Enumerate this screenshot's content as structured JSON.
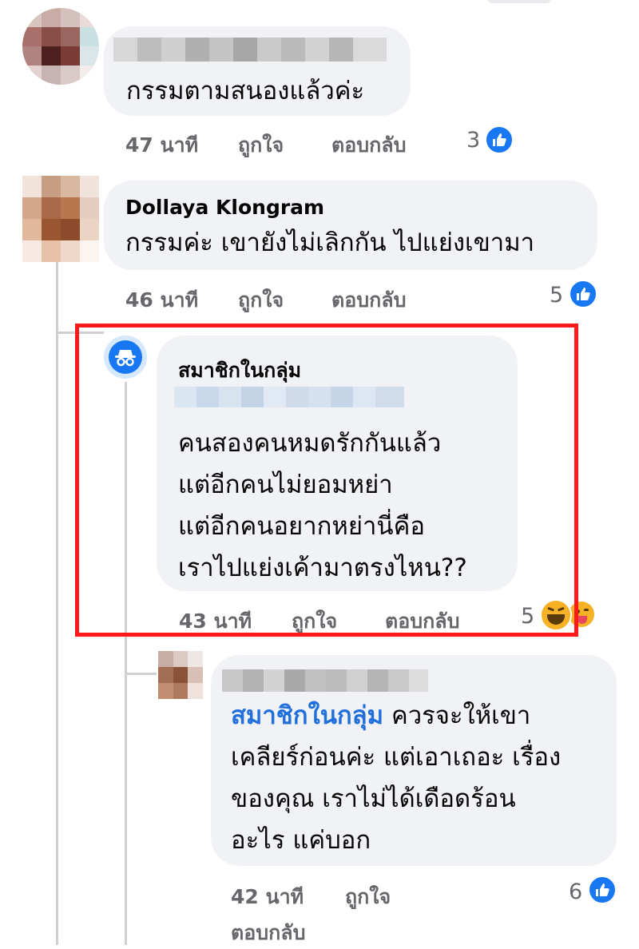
{
  "comments": [
    {
      "name": "",
      "text": [
        "กรรมตามสนองแล้วค่ะ"
      ],
      "time": "47 นาที",
      "like_label": "ถูกใจ",
      "reply_label": "ตอบกลับ",
      "reaction_count": "3",
      "reaction": "like-icon"
    },
    {
      "name": "Dollaya Klongram",
      "text": [
        "กรรมค่ะ เขายังไม่เลิกกัน ไปแย่งเขามา"
      ],
      "time": "46 นาที",
      "like_label": "ถูกใจ",
      "reply_label": "ตอบกลับ",
      "reaction_count": "5",
      "reaction": "like-icon"
    },
    {
      "name": "สมาชิกในกลุ่ม",
      "text": [
        "คนสองคนหมดรักกันแล้ว",
        "แต่อีกคนไม่ยอมหย่า",
        "แต่อีกคนอยากหย่านี่คือ",
        "เราไปแย่งเค้ามาตรงไหน??"
      ],
      "time": "43 นาที",
      "like_label": "ถูกใจ",
      "reply_label": "ตอบกลับ",
      "reaction_count": "5",
      "reaction": "haha-and-tongue-emoji"
    },
    {
      "name": "",
      "mention": "สมาชิกในกลุ่ม",
      "text": [
        " ควรจะให้เขา",
        "เคลียร์ก่อนค่ะ แต่เอาเถอะ เรื่อง",
        "ของคุณ เราไม่ได้เดือดร้อน",
        "อะไร แค่บอก"
      ],
      "time": "42 นาที",
      "like_label": "ถูกใจ",
      "reply_label": "ตอบกลับ",
      "reaction_count": "6",
      "reaction": "like-icon"
    }
  ],
  "colors": {
    "bubble": "#f0f2f5",
    "meta": "#65676b",
    "highlight": "#ff1a1a",
    "mention": "#216fdb",
    "like": "#1877f2"
  }
}
